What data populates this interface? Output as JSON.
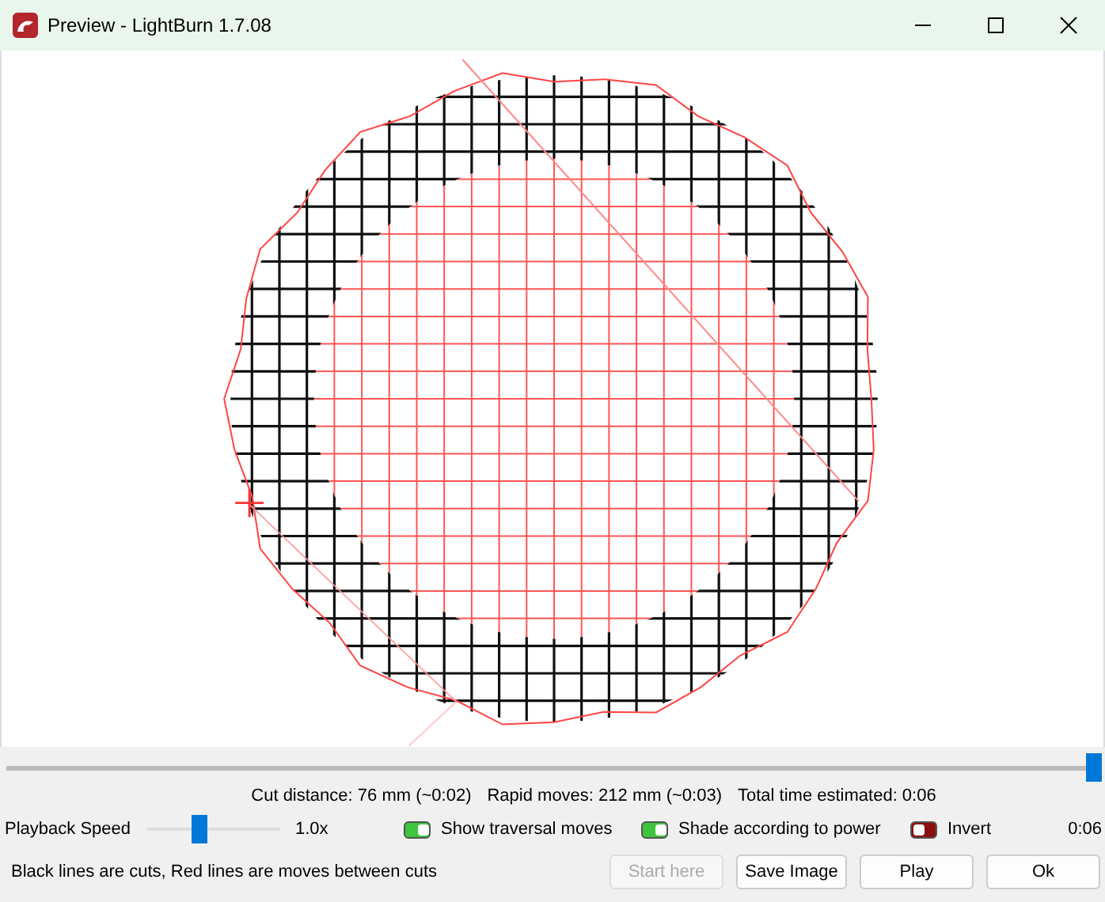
{
  "window": {
    "title": "Preview - LightBurn 1.7.08"
  },
  "canvas": {
    "kind": "picture"
  },
  "progress": {
    "level": 1.0
  },
  "stats": [
    "Cut distance: 76 mm (~0:02)",
    "Rapid moves: 212 mm (~0:03)",
    "Total time estimated: 0:06"
  ],
  "playback_speed": {
    "label": "Playback Speed",
    "level": 0.4,
    "reading": "1.0x"
  },
  "toggles": [
    {
      "label": "Show traversal moves",
      "on": true
    },
    {
      "label": "Shade according to power",
      "on": true
    },
    {
      "label": "Invert",
      "on": false
    }
  ],
  "time": "0:06",
  "legend": "Black lines are cuts, Red lines are moves between cuts",
  "buttons": [
    {
      "label": "Start here",
      "disabled": true
    },
    {
      "label": "Save Image",
      "disabled": false
    },
    {
      "label": "Play",
      "disabled": false
    },
    {
      "label": "Ok",
      "disabled": false
    }
  ]
}
